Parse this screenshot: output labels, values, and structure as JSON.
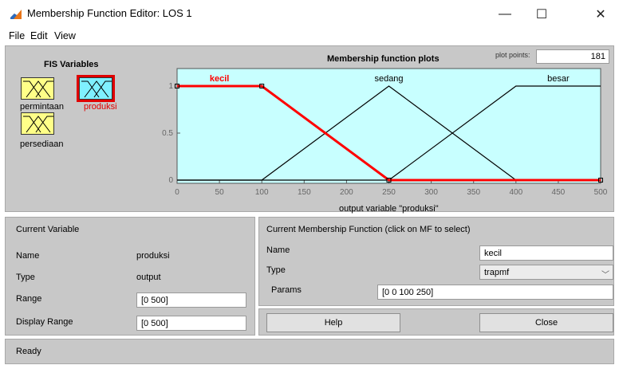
{
  "window": {
    "title": "Membership Function Editor: LOS 1"
  },
  "window_controls": {
    "minimize": "—",
    "maximize": "☐",
    "close": "✕"
  },
  "menu": [
    "File",
    "Edit",
    "View"
  ],
  "fis_variables": {
    "title": "FIS Variables",
    "items": [
      {
        "name": "permintaan",
        "role": "input"
      },
      {
        "name": "produksi",
        "role": "output",
        "selected": true
      },
      {
        "name": "persediaan",
        "role": "input"
      }
    ]
  },
  "plot": {
    "title": "Membership function plots",
    "plot_points_label": "plot points:",
    "plot_points_value": "181",
    "x_title": "output variable \"produksi\""
  },
  "chart_data": {
    "type": "line",
    "xlim": [
      0,
      500
    ],
    "ylim": [
      0,
      1
    ],
    "xticks": [
      "0",
      "50",
      "100",
      "150",
      "200",
      "250",
      "300",
      "350",
      "400",
      "450",
      "500"
    ],
    "yticks": [
      "0",
      "0.5",
      "1"
    ],
    "series": [
      {
        "name": "kecil",
        "x": [
          0,
          0,
          100,
          250,
          500
        ],
        "y": [
          1,
          1,
          1,
          0,
          0
        ],
        "selected": true
      },
      {
        "name": "sedang",
        "x": [
          0,
          100,
          250,
          400,
          500
        ],
        "y": [
          0,
          0,
          1,
          0,
          0
        ]
      },
      {
        "name": "besar",
        "x": [
          0,
          250,
          400,
          500,
          500
        ],
        "y": [
          0,
          0,
          1,
          1,
          1
        ]
      }
    ],
    "colors": {
      "background": "#c8ffff",
      "selected": "#ff0000",
      "normal": "#000000"
    }
  },
  "current_variable": {
    "header": "Current Variable",
    "name_label": "Name",
    "name_value": "produksi",
    "type_label": "Type",
    "type_value": "output",
    "range_label": "Range",
    "range_value": "[0 500]",
    "display_range_label": "Display Range",
    "display_range_value": "[0 500]"
  },
  "current_mf": {
    "header": "Current Membership Function (click on MF to select)",
    "name_label": "Name",
    "name_value": "kecil",
    "type_label": "Type",
    "type_value": "trapmf",
    "params_label": "Params",
    "params_value": "[0 0 100 250]"
  },
  "buttons": {
    "help": "Help",
    "close": "Close"
  },
  "status": {
    "text": "Ready"
  }
}
